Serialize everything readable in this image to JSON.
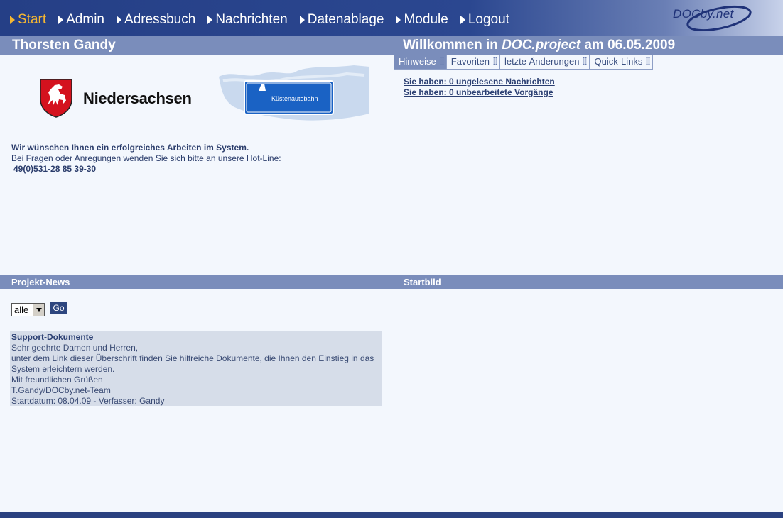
{
  "nav": {
    "items": [
      {
        "label": "Start",
        "active": true
      },
      {
        "label": "Admin",
        "active": false
      },
      {
        "label": "Adressbuch",
        "active": false
      },
      {
        "label": "Nachrichten",
        "active": false
      },
      {
        "label": "Datenablage",
        "active": false
      },
      {
        "label": "Module",
        "active": false
      },
      {
        "label": "Logout",
        "active": false
      }
    ],
    "brand": "DOCby.net"
  },
  "header": {
    "user_name": "Thorsten Gandy",
    "welcome_prefix": "Willkommen in",
    "welcome_product": "DOC.project",
    "welcome_suffix": "am 06.05.2009"
  },
  "tabs": [
    {
      "label": "Hinweise",
      "active": true
    },
    {
      "label": "Favoriten",
      "active": false
    },
    {
      "label": "letzte Änderungen",
      "active": false
    },
    {
      "label": "Quick-Links",
      "active": false
    }
  ],
  "notices": {
    "unread_messages": "Sie haben: 0 ungelesene Nachrichten",
    "open_tasks": "Sie haben: 0 unbearbeitete Vorgänge"
  },
  "logos": {
    "state_name": "Niedersachsen",
    "sign_text": "Küstenautobahn"
  },
  "intro": {
    "lead": "Wir wünschen Ihnen ein erfolgreiches Arbeiten im System.",
    "line2": "Bei Fragen oder Anregungen wenden Sie sich bitte an unsere Hot-Line:",
    "hotline": "49(0)531-28 85 39-30"
  },
  "sections": {
    "news_title": "Projekt-News",
    "start_image_title": "Startbild"
  },
  "filter": {
    "selected": "alle",
    "go_label": "Go"
  },
  "news": {
    "title": "Support-Dokumente",
    "lines": [
      "Sehr geehrte Damen und Herren,",
      "unter dem Link dieser Überschrift finden Sie hilfreiche Dokumente, die Ihnen den Einstieg in das System erleichtern werden.",
      "Mit freundlichen Grüßen",
      "T.Gandy/DOCby.net-Team",
      "Startdatum: 08.04.09 - Verfasser: Gandy"
    ]
  },
  "colors": {
    "nav_bg": "#253f86",
    "active_nav": "#f5b731",
    "bar_bg": "#7a8dbb",
    "page_bg": "#f3f7fd"
  }
}
